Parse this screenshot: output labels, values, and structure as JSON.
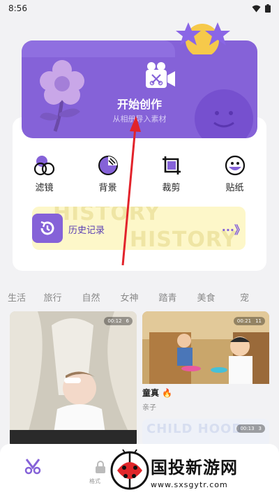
{
  "status_bar": {
    "time": "8:56"
  },
  "hero": {
    "title": "开始创作",
    "subtitle": "从相册导入素材",
    "colors": {
      "background": "#8562d8"
    }
  },
  "tools": [
    {
      "label": "滤镜",
      "icon": "filter-icon"
    },
    {
      "label": "背景",
      "icon": "background-icon"
    },
    {
      "label": "裁剪",
      "icon": "crop-icon"
    },
    {
      "label": "贴纸",
      "icon": "sticker-icon"
    }
  ],
  "history": {
    "label": "历史记录",
    "watermark_1": "HISTORY",
    "watermark_2": "HISTORY",
    "arrows": "···》"
  },
  "categories": [
    "生活",
    "旅行",
    "自然",
    "女神",
    "踏青",
    "美食",
    "宠"
  ],
  "cards": {
    "left": {
      "duration": "00:12",
      "layers": "6"
    },
    "right": {
      "duration": "00:21",
      "layers": "11",
      "title": "童真",
      "subtitle": "亲子"
    },
    "right2": {
      "duration": "00:13",
      "layers": "3",
      "label": "CHILD HOOD"
    }
  },
  "bottom_nav": {
    "label": "格式"
  },
  "watermark": {
    "text": "国投新游网",
    "url": "www.sxsgytr.com"
  }
}
